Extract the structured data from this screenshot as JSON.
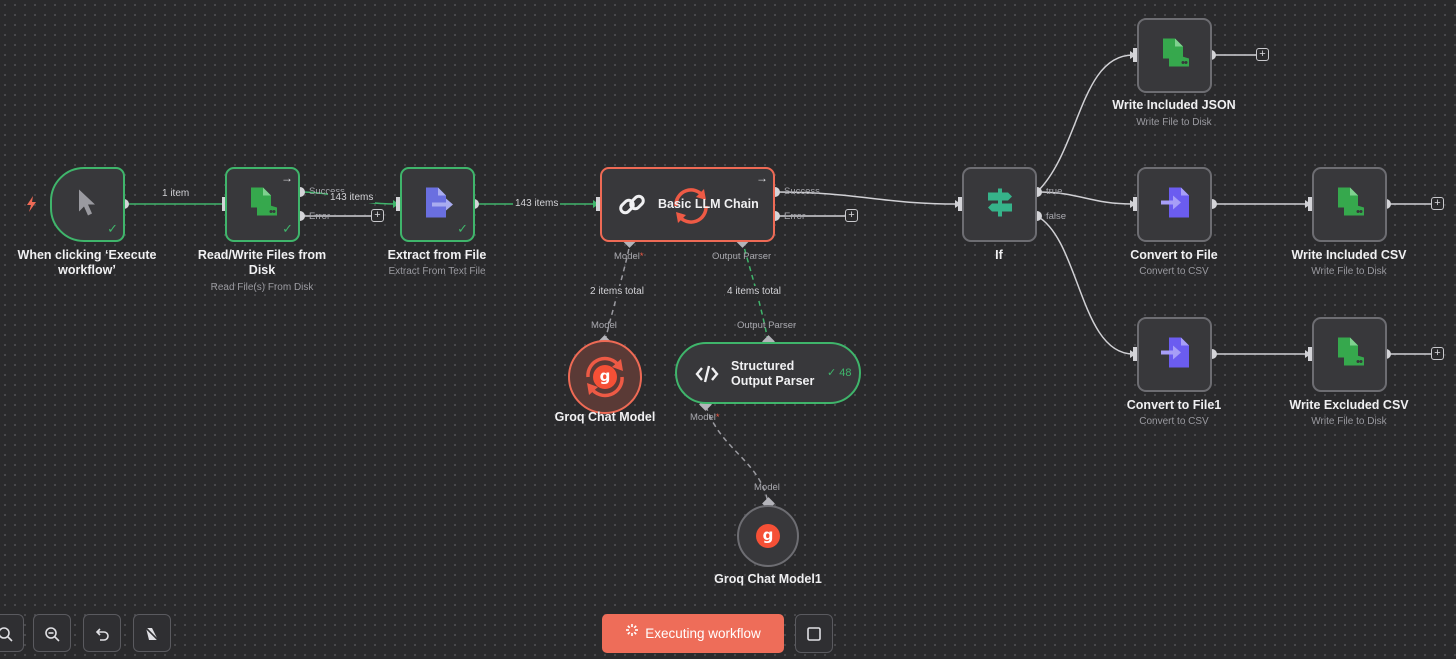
{
  "nodes": {
    "trigger": {
      "label": "When clicking ‘Execute workflow’",
      "icon": "cursor-icon"
    },
    "read_write": {
      "label": "Read/Write Files from Disk",
      "sub": "Read File(s) From Disk",
      "icon": "file-disk-icon"
    },
    "extract": {
      "label": "Extract from File",
      "sub": "Extract From Text File",
      "icon": "file-arrow-icon"
    },
    "llm_chain": {
      "label": "Basic LLM Chain",
      "icon": "chain-link-icon"
    },
    "groq1": {
      "label": "Groq Chat Model",
      "icon": "groq-icon"
    },
    "parser": {
      "label_line1": "Structured",
      "label_line2": "Output Parser",
      "count": "48",
      "icon": "code-icon"
    },
    "groq2": {
      "label": "Groq Chat Model1",
      "icon": "groq-icon"
    },
    "if": {
      "label": "If",
      "icon": "signpost-icon"
    },
    "write_json": {
      "label": "Write Included JSON",
      "sub": "Write File to Disk",
      "icon": "file-disk-icon"
    },
    "convert": {
      "label": "Convert to File",
      "sub": "Convert to CSV",
      "icon": "convert-file-icon"
    },
    "write_csv": {
      "label": "Write Included CSV",
      "sub": "Write File to Disk",
      "icon": "file-disk-icon"
    },
    "convert1": {
      "label": "Convert to File1",
      "sub": "Convert to CSV",
      "icon": "convert-file-icon"
    },
    "write_excluded": {
      "label": "Write Excluded CSV",
      "sub": "Write File to Disk",
      "icon": "file-disk-icon"
    }
  },
  "outputs": {
    "success": "Success",
    "error": "Error",
    "true": "true",
    "false": "false"
  },
  "connectors": {
    "model_required": "Model",
    "output_parser": "Output Parser",
    "model": "Model"
  },
  "edges": {
    "trigger_to_rw": "1 item",
    "rw_to_extract": "143 items",
    "extract_to_llm": "143 items",
    "groq_to_llm": "2 items total",
    "parser_to_llm": "4 items total"
  },
  "controls": {
    "zoom_in": "zoom-in-icon",
    "zoom_out": "zoom-out-icon",
    "undo": "undo-icon",
    "clear": "eraser-icon",
    "executing": "Executing workflow",
    "stop": "stop-icon"
  },
  "colors": {
    "success": "#3fb56b",
    "error": "#ee6a55",
    "file_green": "#36a84d",
    "file_purple": "#6b5cf0",
    "groq": "#f55036",
    "execute_button": "#ee6d59"
  }
}
